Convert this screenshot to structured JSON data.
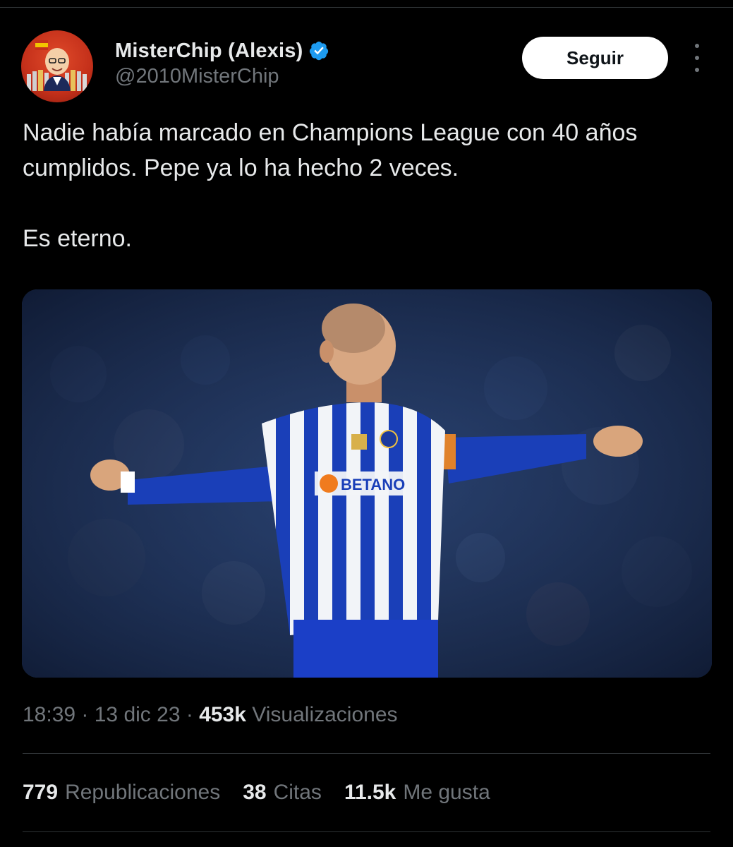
{
  "author": {
    "display_name": "MisterChip (Alexis)",
    "handle": "@2010MisterChip",
    "verified_icon": "verified-badge-icon",
    "verified_color": "#1d9bf0"
  },
  "header": {
    "follow_label": "Seguir",
    "more_icon": "more-dots-icon"
  },
  "tweet": {
    "text": "Nadie había marcado en Champions League con 40 años cumplidos. Pepe ya lo ha hecho 2 veces.\n\nEs eterno."
  },
  "media": {
    "sponsor_text": "BETANO"
  },
  "meta": {
    "time": "18:39",
    "sep1": " · ",
    "date": "13 dic 23",
    "sep2": " · ",
    "views_count": "453k",
    "views_label": " Visualizaciones"
  },
  "stats": {
    "reposts_count": "779",
    "reposts_label": "Republicaciones",
    "quotes_count": "38",
    "quotes_label": "Citas",
    "likes_count": "11.5k",
    "likes_label": "Me gusta"
  },
  "colors": {
    "background": "#000000",
    "text_primary": "#e7e9ea",
    "text_secondary": "#71767b",
    "divider": "#2f3336",
    "accent": "#1d9bf0"
  }
}
